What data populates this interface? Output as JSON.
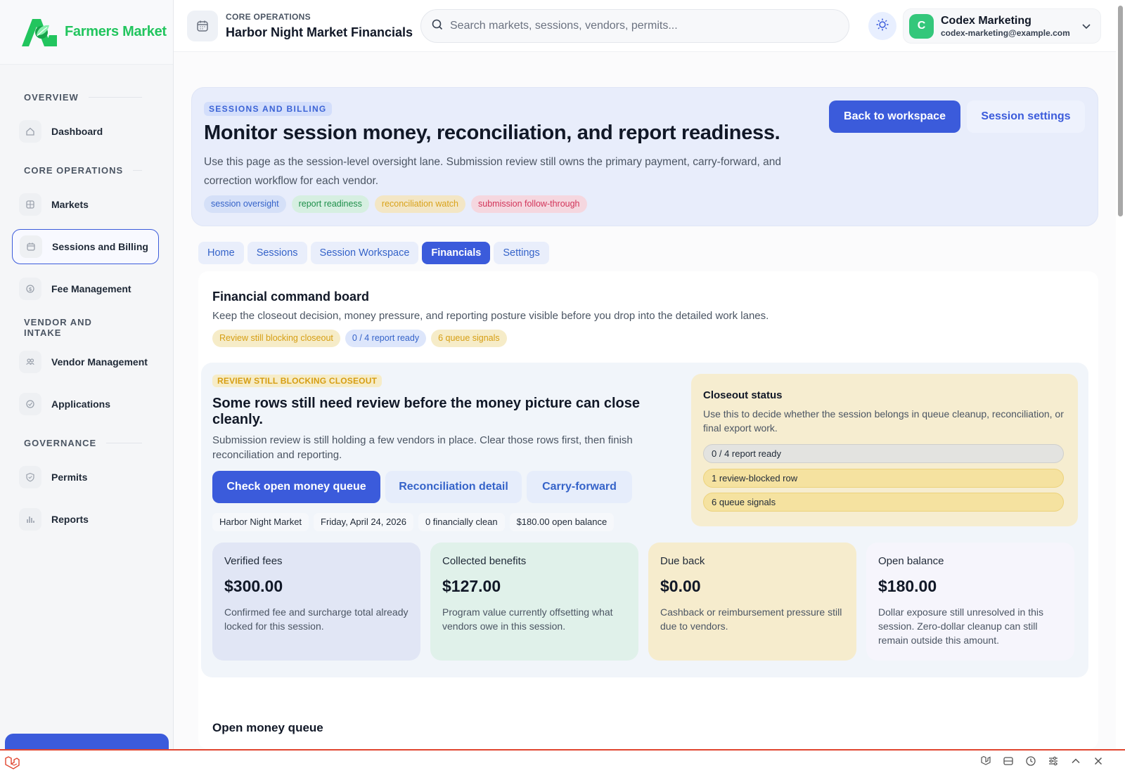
{
  "brand": {
    "name": "Farmers Market"
  },
  "sidebar": {
    "sections": [
      {
        "title": "OVERVIEW",
        "items": [
          {
            "label": "Dashboard",
            "icon": "home-icon"
          }
        ]
      },
      {
        "title": "CORE OPERATIONS",
        "items": [
          {
            "label": "Markets",
            "icon": "grid-icon"
          },
          {
            "label": "Sessions and Billing",
            "icon": "calendar-icon",
            "active": true
          },
          {
            "label": "Fee Management",
            "icon": "dollar-icon"
          }
        ]
      },
      {
        "title": "VENDOR AND INTAKE",
        "items": [
          {
            "label": "Vendor Management",
            "icon": "users-icon"
          },
          {
            "label": "Applications",
            "icon": "clipboard-icon"
          }
        ]
      },
      {
        "title": "GOVERNANCE",
        "items": [
          {
            "label": "Permits",
            "icon": "shield-icon"
          },
          {
            "label": "Reports",
            "icon": "bar-chart-icon"
          }
        ]
      }
    ]
  },
  "header": {
    "kicker": "CORE OPERATIONS",
    "title": "Harbor Night Market Financials",
    "search_placeholder": "Search markets, sessions, vendors, permits...",
    "user": {
      "initial": "C",
      "name": "Codex Marketing",
      "email": "codex-marketing@example.com"
    }
  },
  "hero": {
    "kicker": "SESSIONS AND BILLING",
    "title": "Monitor session money, reconciliation, and report readiness.",
    "description": "Use this page as the session-level oversight lane. Submission review still owns the primary payment, carry-forward, and correction workflow for each vendor.",
    "tags": [
      "session oversight",
      "report readiness",
      "reconciliation watch",
      "submission follow-through"
    ],
    "primary_button": "Back to workspace",
    "secondary_button": "Session settings"
  },
  "tabs": [
    "Home",
    "Sessions",
    "Session Workspace",
    "Financials",
    "Settings"
  ],
  "active_tab": "Financials",
  "board": {
    "title": "Financial command board",
    "subtitle": "Keep the closeout decision, money pressure, and reporting posture visible before you drop into the detailed work lanes.",
    "tags": [
      "Review still blocking closeout",
      "0 / 4 report ready",
      "6 queue signals"
    ]
  },
  "alert": {
    "kicker": "REVIEW STILL BLOCKING CLOSEOUT",
    "title": "Some rows still need review before the money picture can close cleanly.",
    "description": "Submission review is still holding a few vendors in place. Clear those rows first, then finish reconciliation and reporting.",
    "buttons": [
      "Check open money queue",
      "Reconciliation detail",
      "Carry-forward"
    ],
    "meta": [
      "Harbor Night Market",
      "Friday, April 24, 2026",
      "0 financially clean",
      "$180.00 open balance"
    ]
  },
  "closeout": {
    "title": "Closeout status",
    "description": "Use this to decide whether the session belongs in queue cleanup, reconciliation, or final export work.",
    "rows": [
      "0 / 4 report ready",
      "1 review-blocked row",
      "6 queue signals"
    ]
  },
  "stats": [
    {
      "label": "Verified fees",
      "value": "$300.00",
      "description": "Confirmed fee and surcharge total already locked for this session."
    },
    {
      "label": "Collected benefits",
      "value": "$127.00",
      "description": "Program value currently offsetting what vendors owe in this session."
    },
    {
      "label": "Due back",
      "value": "$0.00",
      "description": "Cashback or reimbursement pressure still due to vendors."
    },
    {
      "label": "Open balance",
      "value": "$180.00",
      "description": "Dollar exposure still unresolved in this session. Zero-dollar cleanup can still remain outside this amount."
    }
  ],
  "queue": {
    "title": "Open money queue"
  },
  "colors": {
    "accent": "#3b5bdb",
    "brand_green": "#22c55e",
    "debug_red": "#e0452f"
  }
}
